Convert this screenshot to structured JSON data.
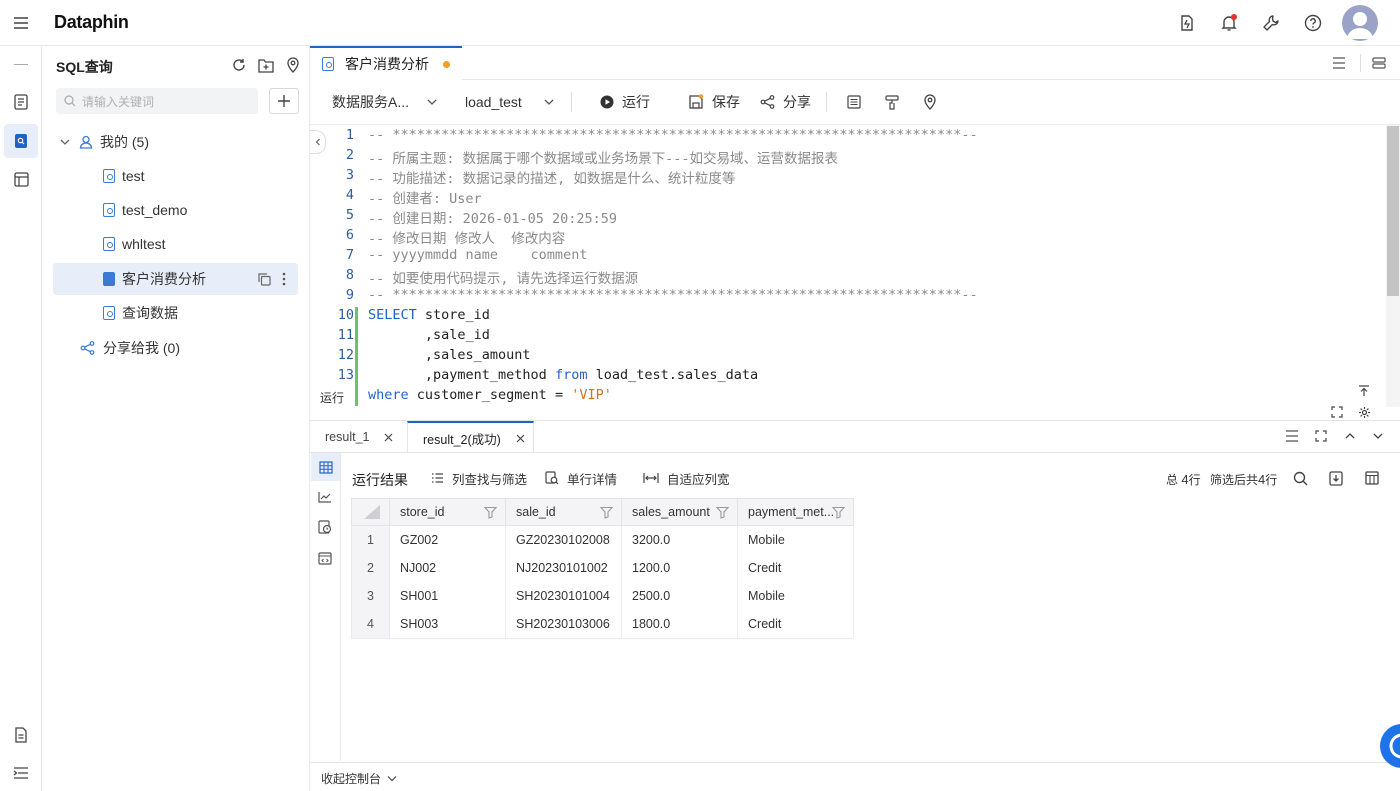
{
  "app": {
    "brand": "Dataphin"
  },
  "sidebar": {
    "title": "SQL查询",
    "search_placeholder": "请输入关键词",
    "mine_label": "我的 (5)",
    "items": [
      {
        "label": "test"
      },
      {
        "label": "test_demo"
      },
      {
        "label": "whltest"
      },
      {
        "label": "客户消费分析"
      },
      {
        "label": "查询数据"
      }
    ],
    "shared_label": "分享给我 (0)"
  },
  "editor_tab": {
    "title": "客户消费分析"
  },
  "toolbar": {
    "datasource": "数据服务A...",
    "project": "load_test",
    "run": "运行",
    "save": "保存",
    "share": "分享"
  },
  "code": {
    "line_numbers": [
      "1",
      "2",
      "3",
      "4",
      "5",
      "6",
      "7",
      "8",
      "9",
      "10",
      "11",
      "12",
      "13"
    ],
    "lines": [
      "-- **********************************************************************--",
      "-- 所属主题: 数据属于哪个数据域或业务场景下---如交易域、运营数据报表",
      "-- 功能描述: 数据记录的描述, 如数据是什么、统计粒度等",
      "-- 创建者: User",
      "-- 创建日期: 2026-01-05 20:25:59",
      "-- 修改日期 修改人  修改内容",
      "-- yyyymmdd name    comment",
      "-- 如要使用代码提示, 请先选择运行数据源",
      "-- **********************************************************************--"
    ],
    "sql": {
      "select_kw": "SELECT",
      "select_col": " store_id",
      "l11": "       ,sale_id",
      "l12": "       ,sales_amount",
      "l13_a": "       ,payment_method ",
      "from_kw": "from",
      "l13_b": " load_test.sales_data",
      "where_kw": "where",
      "l14_a": " customer_segment = ",
      "l14_str": "'VIP'"
    },
    "run_marker": "运行"
  },
  "results": {
    "tabs": [
      {
        "label": "result_1"
      },
      {
        "label": "result_2(成功)"
      }
    ],
    "panel_title": "运行结果",
    "filter_btn": "列查找与筛选",
    "row_detail_btn": "单行详情",
    "autofit_btn": "自适应列宽",
    "total_prefix": "总",
    "total_count": "4",
    "total_suffix": "行",
    "filtered_prefix": "筛选后共",
    "filtered_count": "4",
    "filtered_suffix": "行",
    "columns": [
      "store_id",
      "sale_id",
      "sales_amount",
      "payment_met..."
    ],
    "rows": [
      [
        "1",
        "GZ002",
        "GZ20230102008",
        "3200.0",
        "Mobile"
      ],
      [
        "2",
        "NJ002",
        "NJ20230101002",
        "1200.0",
        "Credit"
      ],
      [
        "3",
        "SH001",
        "SH20230101004",
        "2500.0",
        "Mobile"
      ],
      [
        "4",
        "SH003",
        "SH20230103006",
        "1800.0",
        "Credit"
      ]
    ]
  },
  "console": {
    "collapse_label": "收起控制台"
  },
  "colors": {
    "accent": "#1f63c9",
    "highlight_row": "#e8eef9",
    "tab_dot": "#f0a020",
    "notif": "#e5322d"
  }
}
